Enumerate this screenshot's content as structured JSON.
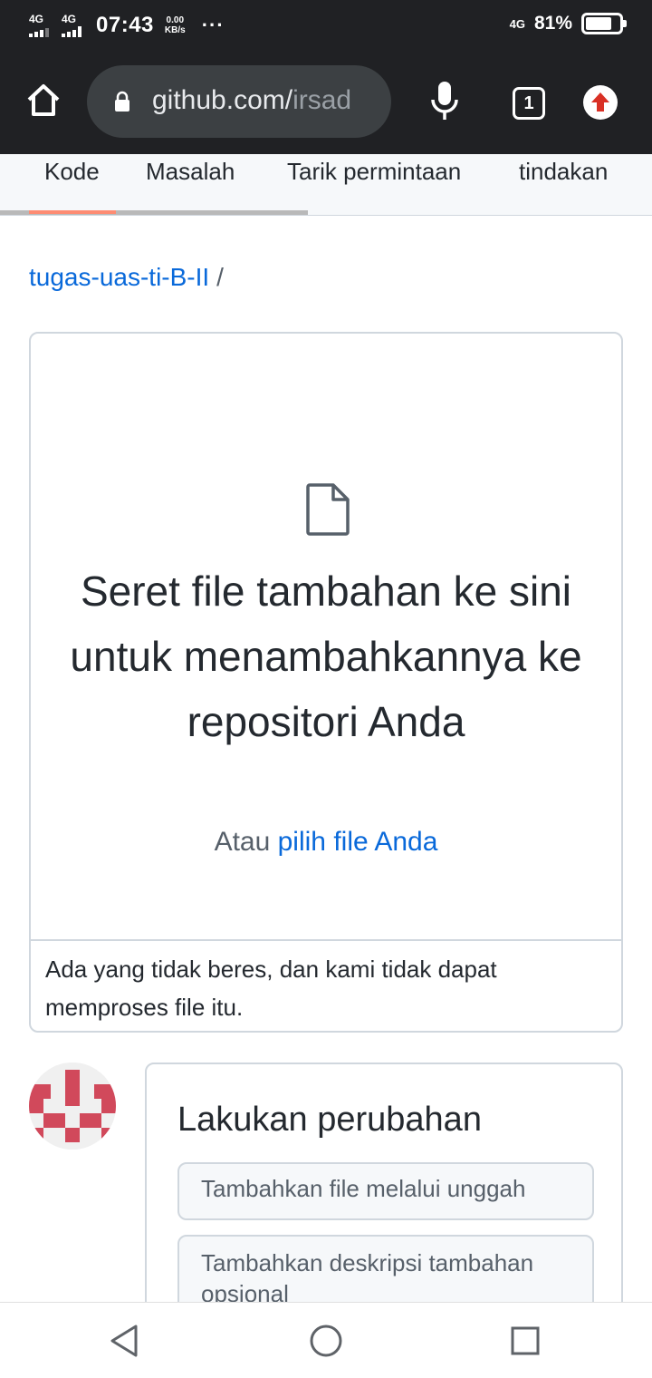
{
  "status_bar": {
    "network1": "4G",
    "network2": "4G",
    "time": "07:43",
    "speed_value": "0.00",
    "speed_unit": "KB/s",
    "more": "···",
    "network_right": "4G",
    "battery_percent": "81%",
    "battery_level": 0.81
  },
  "browser": {
    "url_host": "github.com/",
    "url_path": "irsad",
    "tab_count": "1",
    "icons": [
      "home-icon",
      "lock-icon",
      "mic-icon",
      "tabs-icon",
      "update-icon"
    ]
  },
  "repo_tabs": [
    "Kode",
    "Masalah",
    "Tarik permintaan",
    "tindakan"
  ],
  "breadcrumb": {
    "repo": "tugas-uas-ti-B-II",
    "separator": "/"
  },
  "drop_zone": {
    "title": "Seret file tambahan ke sini untuk menambahkannya ke repositori Anda",
    "or_text": "Atau",
    "choose_link": "pilih file Anda",
    "error": "Ada yang tidak beres, dan kami tidak dapat memproses file itu."
  },
  "commit": {
    "title": "Lakukan perubahan",
    "summary_placeholder": "Tambahkan file melalui unggah",
    "description_placeholder": "Tambahkan deskripsi tambahan opsional"
  },
  "colors": {
    "link": "#0969da",
    "tab_underline": "#fd8c73",
    "avatar": "#d1495b",
    "toolbar": "#202124",
    "update": "#d93025"
  }
}
